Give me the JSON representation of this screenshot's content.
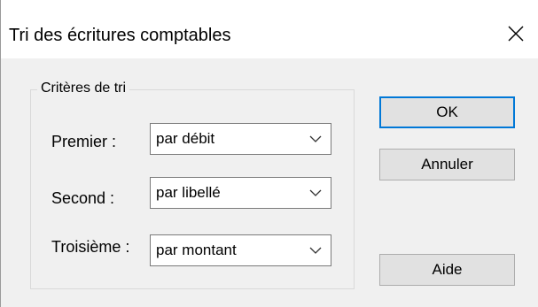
{
  "window": {
    "title": "Tri des écritures comptables"
  },
  "group": {
    "legend": "Critères de tri",
    "rows": [
      {
        "label": "Premier :",
        "value": "par débit"
      },
      {
        "label": "Second :",
        "value": "par libellé"
      },
      {
        "label": "Troisième :",
        "value": "par montant"
      }
    ]
  },
  "buttons": {
    "ok": "OK",
    "cancel": "Annuler",
    "help": "Aide"
  },
  "colors": {
    "accent": "#0078d7",
    "dialog_bg": "#f0f0f0",
    "button_bg": "#e1e1e1"
  },
  "icons": {
    "close": "close-icon",
    "dropdown": "chevron-down-icon"
  }
}
